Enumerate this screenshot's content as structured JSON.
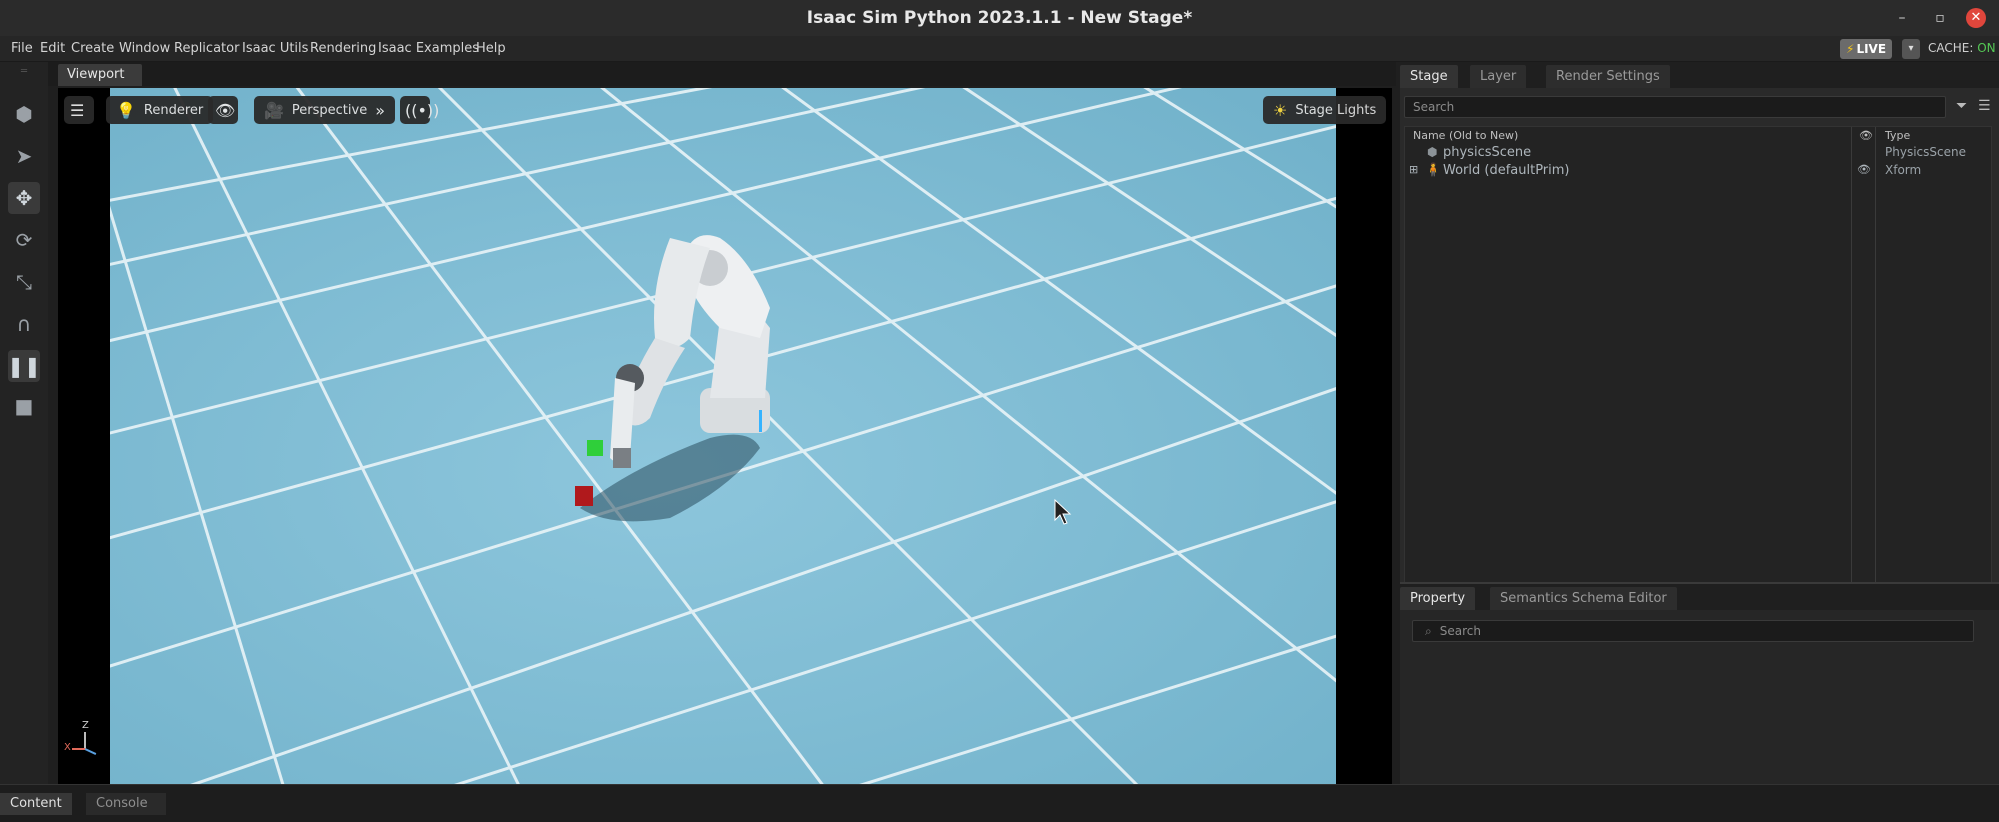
{
  "window": {
    "title": "Isaac Sim Python 2023.1.1 - New Stage*",
    "minimize": "–",
    "restore": "▫",
    "close": "✕"
  },
  "menu": [
    "File",
    "Edit",
    "Create",
    "Window",
    "Replicator",
    "Isaac Utils",
    "Rendering",
    "Isaac Examples",
    "Help"
  ],
  "status": {
    "live": "LIVE",
    "cache_label": "CACHE: ",
    "cache_value": "ON"
  },
  "viewport": {
    "tab": "Viewport",
    "renderer": "Renderer",
    "camera": "Perspective",
    "stage_lights": "Stage Lights",
    "axis_z": "Z",
    "axis_x": "X",
    "floor_color": "#7fbcd4"
  },
  "stage_panel": {
    "tabs": [
      "Stage",
      "Layer",
      "Render Settings"
    ],
    "search_placeholder": "Search",
    "columns": {
      "name": "Name (Old to New)",
      "type": "Type"
    },
    "rows": [
      {
        "name": "physicsScene",
        "type": "PhysicsScene"
      },
      {
        "name": "World (defaultPrim)",
        "type": "Xform"
      }
    ]
  },
  "property_panel": {
    "tabs": [
      "Property",
      "Semantics Schema Editor"
    ],
    "search_placeholder": "Search"
  },
  "bottom_tabs": [
    "Content",
    "Console"
  ]
}
